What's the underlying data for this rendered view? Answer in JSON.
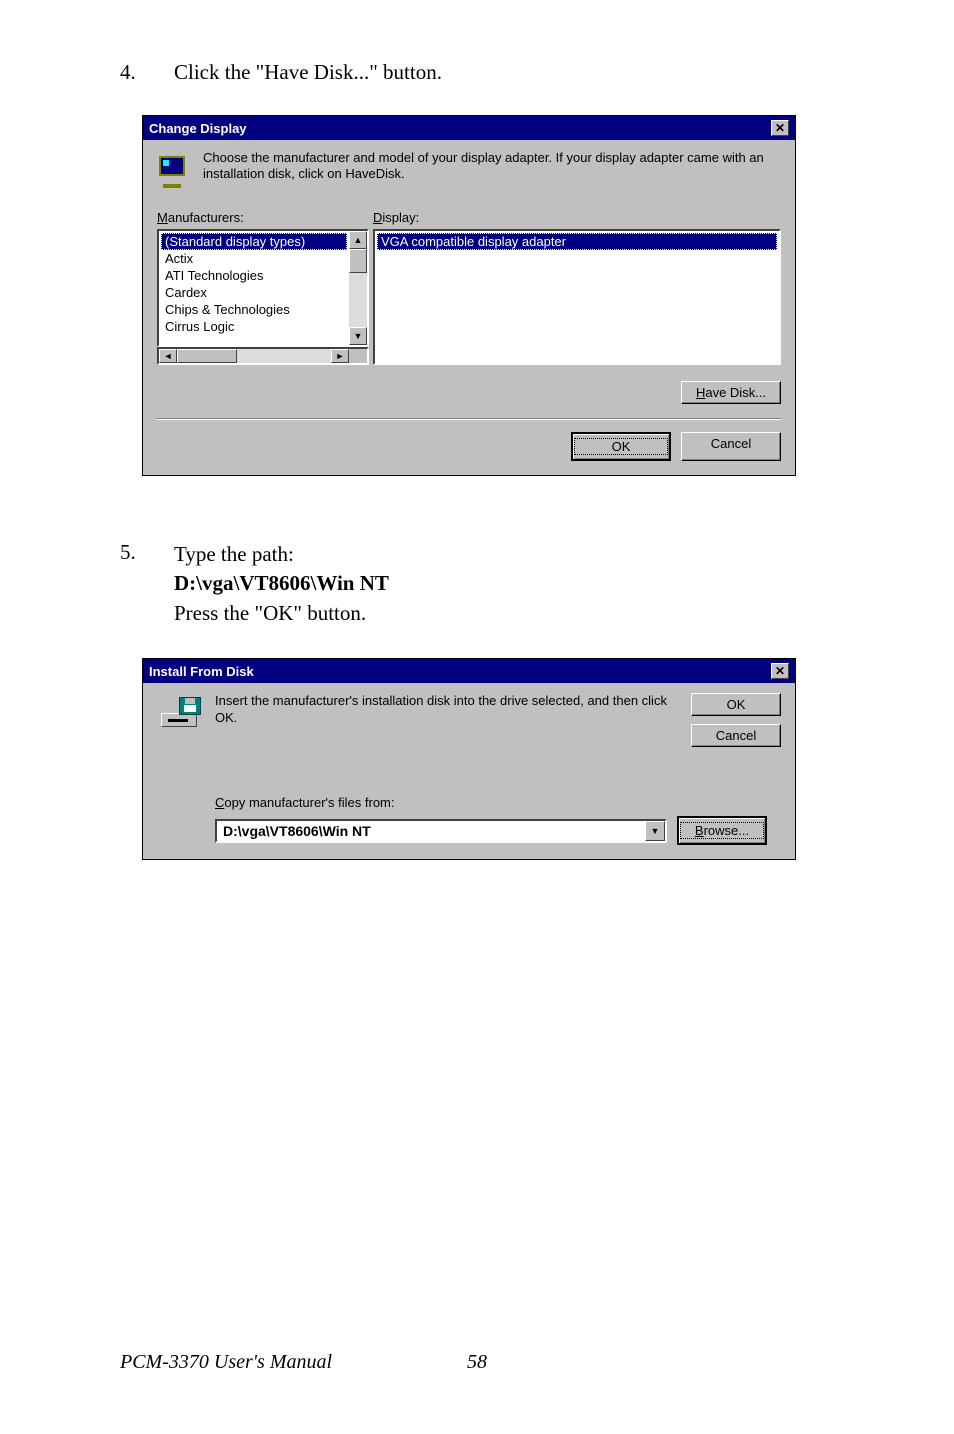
{
  "step4": {
    "number": "4.",
    "text": "Click the \"Have Disk...\" button."
  },
  "changeDisplay": {
    "title": "Change Display",
    "intro": "Choose the manufacturer and model of your display adapter.  If your display adapter came with an installation disk, click on HaveDisk.",
    "manufacturersLabel": "Manufacturers:",
    "displayLabel": "Display:",
    "manufacturers": [
      "(Standard display types)",
      "Actix",
      "ATI Technologies",
      "Cardex",
      "Chips & Technologies",
      "Cirrus Logic"
    ],
    "displays": [
      "VGA compatible display adapter"
    ],
    "haveDisk": "Have Disk...",
    "ok": "OK",
    "cancel": "Cancel"
  },
  "step5": {
    "number": "5.",
    "line1": "Type the path:",
    "line2": "D:\\vga\\VT8606\\Win NT",
    "line3": "Press the \"OK\" button."
  },
  "installFromDisk": {
    "title": "Install From Disk",
    "intro": "Insert the manufacturer's installation disk into the drive selected, and then click OK.",
    "ok": "OK",
    "cancel": "Cancel",
    "copyLabel": "Copy manufacturer's files from:",
    "path": "D:\\vga\\VT8606\\Win NT",
    "browse": "Browse..."
  },
  "footer": {
    "title": "PCM-3370 User's Manual",
    "page": "58"
  }
}
